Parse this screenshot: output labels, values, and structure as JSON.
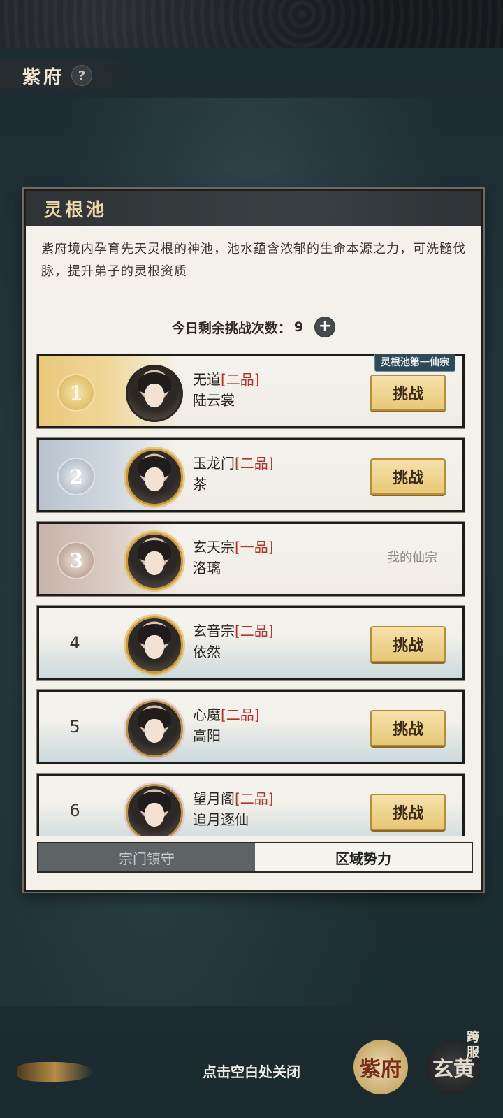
{
  "page_title": "紫府",
  "help_icon": "?",
  "panel": {
    "title": "灵根池",
    "description": "紫府境内孕育先天灵根的神池，池水蕴含浓郁的生命本源之力，可洗髓伐脉，提升弟子的灵根资质",
    "remaining_label": "今日剩余挑战次数：",
    "remaining_count": "9",
    "plus_icon": "+",
    "rows": [
      {
        "rank": "1",
        "sect": "无道",
        "grade": "[二品]",
        "name": "陆云裳",
        "action": "挑战",
        "badge": "灵根池第一仙宗"
      },
      {
        "rank": "2",
        "sect": "玉龙门",
        "grade": "[二品]",
        "name": "茶",
        "action": "挑战"
      },
      {
        "rank": "3",
        "sect": "玄天宗",
        "grade": "[一品]",
        "name": "洛璃",
        "mine": "我的仙宗"
      },
      {
        "rank": "4",
        "sect": "玄音宗",
        "grade": "[二品]",
        "name": "依然",
        "action": "挑战"
      },
      {
        "rank": "5",
        "sect": "心魔",
        "grade": "[二品]",
        "name": "高阳",
        "action": "挑战"
      },
      {
        "rank": "6",
        "sect": "望月阁",
        "grade": "[二品]",
        "name": "追月逐仙",
        "action": "挑战"
      }
    ],
    "tabs": [
      {
        "label": "宗门镇守",
        "active": false
      },
      {
        "label": "区域势力",
        "active": true
      }
    ]
  },
  "close_hint": "点击空白处关闭",
  "bottom_buttons": {
    "zifu": "紫府",
    "xuanhuang": "玄黄",
    "cross_server": "跨服"
  }
}
